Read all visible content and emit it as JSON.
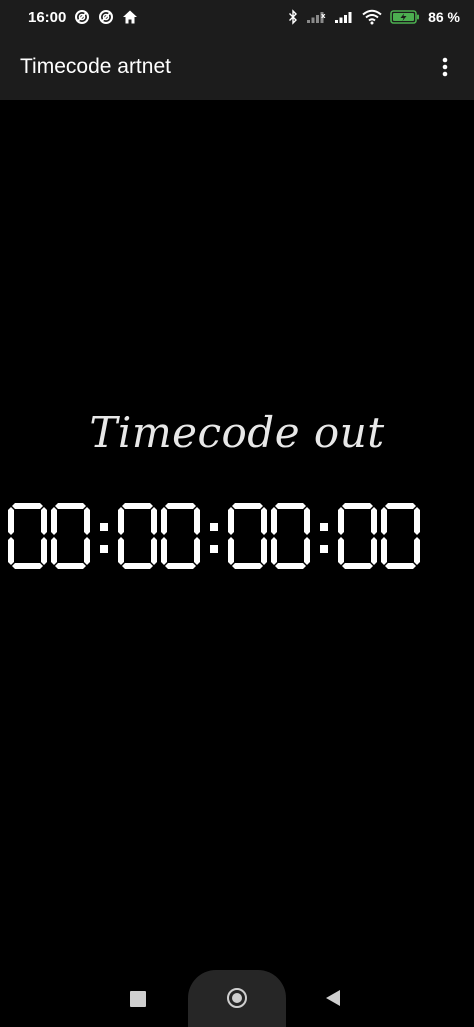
{
  "status_bar": {
    "time": "16:00",
    "battery_percent": "86",
    "battery_suffix": "%",
    "left_icons": [
      "sync-icon",
      "sync-icon",
      "home-icon"
    ],
    "right_icons": [
      "bluetooth-icon",
      "signal-icon",
      "signal-icon",
      "wifi-icon",
      "battery-charging-icon"
    ],
    "battery_color": "#4caf50"
  },
  "app_bar": {
    "title": "Timecode artnet",
    "menu_icon": "more-vert-icon"
  },
  "main": {
    "label": "Timecode out",
    "timecode": {
      "hours": "00",
      "minutes": "00",
      "seconds": "00",
      "frames": "00"
    }
  },
  "colors": {
    "background": "#000000",
    "bar": "#1c1c1c",
    "digit": "#ffffff",
    "label": "#e8e8e8"
  },
  "nav_bar": {
    "icons": [
      "recents-icon",
      "home-icon",
      "back-icon"
    ]
  }
}
